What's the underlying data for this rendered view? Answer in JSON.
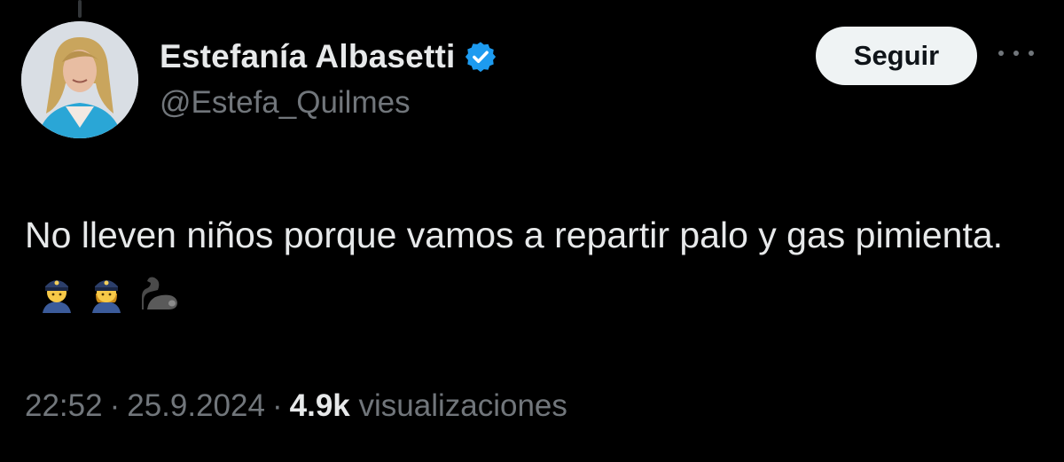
{
  "author": {
    "display_name": "Estefanía Albasetti",
    "handle": "@Estefa_Quilmes",
    "verified": true,
    "verified_color": "#1d9bf0"
  },
  "follow_button": {
    "label": "Seguir"
  },
  "more_button": {
    "icon": "more-horizontal-icon"
  },
  "tweet": {
    "text": "No lleven niños porque vamos a repartir palo y gas pimienta.",
    "emojis": [
      "police-officer-emoji",
      "police-officer-emoji",
      "flexed-biceps-emoji"
    ]
  },
  "meta": {
    "time": "22:52",
    "separator": "·",
    "date": "25.9.2024",
    "views_count": "4.9k",
    "views_label": "visualizaciones"
  },
  "colors": {
    "background": "#000000",
    "primary_text": "#e7e9ea",
    "secondary_text": "#71767b",
    "button_bg": "#eff3f4"
  }
}
